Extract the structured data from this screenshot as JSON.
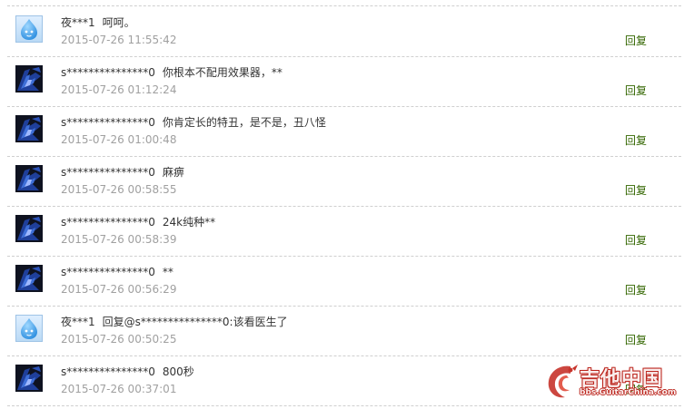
{
  "comments": [
    {
      "user": "夜***1",
      "text": "呵呵。",
      "time": "2015-07-26 11:55:42",
      "reply_label": "回复",
      "avatar_icon": "water-drop-avatar-icon"
    },
    {
      "user": "s***************0",
      "text": "你根本不配用效果器，**",
      "time": "2015-07-26 01:12:24",
      "reply_label": "回复",
      "avatar_icon": "dark-blue-avatar-icon"
    },
    {
      "user": "s***************0",
      "text": "你肯定长的特丑，是不是，丑八怪",
      "time": "2015-07-26 01:00:48",
      "reply_label": "回复",
      "avatar_icon": "dark-blue-avatar-icon"
    },
    {
      "user": "s***************0",
      "text": "麻痹",
      "time": "2015-07-26 00:58:55",
      "reply_label": "回复",
      "avatar_icon": "dark-blue-avatar-icon"
    },
    {
      "user": "s***************0",
      "text": "24k纯种**",
      "time": "2015-07-26 00:58:39",
      "reply_label": "回复",
      "avatar_icon": "dark-blue-avatar-icon"
    },
    {
      "user": "s***************0",
      "text": "**",
      "time": "2015-07-26 00:56:29",
      "reply_label": "回复",
      "avatar_icon": "dark-blue-avatar-icon"
    },
    {
      "user": "夜***1",
      "text": "回复@s***************0:该看医生了",
      "time": "2015-07-26 00:50:25",
      "reply_label": "回复",
      "avatar_icon": "water-drop-avatar-icon"
    },
    {
      "user": "s***************0",
      "text": "800秒",
      "time": "2015-07-26 00:37:01",
      "reply_label": "回复",
      "avatar_icon": "dark-blue-avatar-icon"
    }
  ],
  "watermark": {
    "site_name_cn": "吉他中国",
    "site_url": "bbs.GuitarChina.com"
  },
  "colors": {
    "reply_link": "#336600",
    "timestamp": "#a0a0a0",
    "divider": "#cfcfcf",
    "watermark_red": "#bd2a22"
  }
}
